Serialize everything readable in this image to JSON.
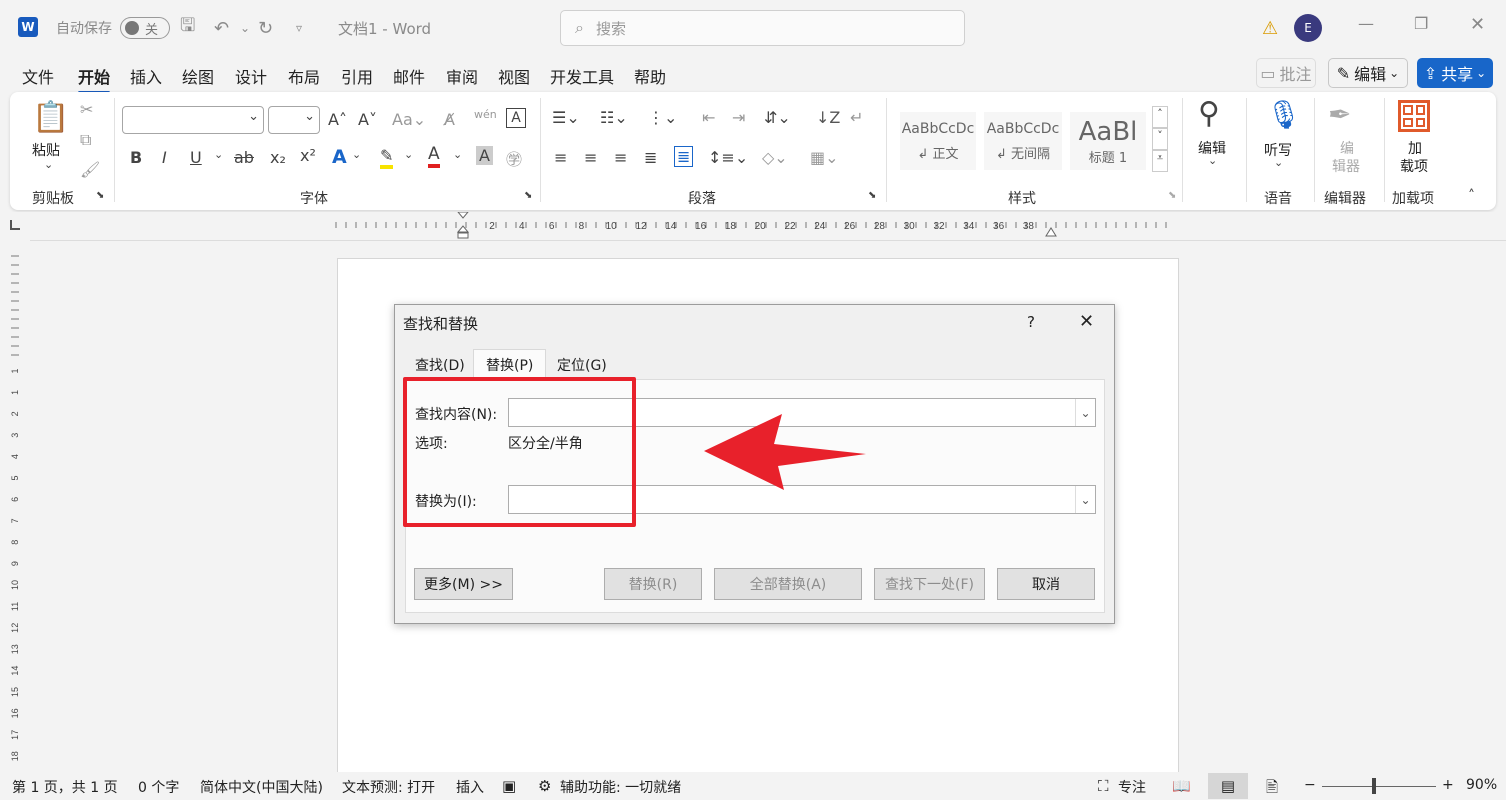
{
  "titlebar": {
    "autosave_label": "自动保存",
    "autosave_state": "关",
    "doc_title": "文档1 - Word",
    "search_placeholder": "搜索",
    "avatar_initial": "E"
  },
  "menu": [
    "文件",
    "开始",
    "插入",
    "绘图",
    "设计",
    "布局",
    "引用",
    "邮件",
    "审阅",
    "视图",
    "开发工具",
    "帮助"
  ],
  "menu_active": "开始",
  "right_actions": {
    "comment": "批注",
    "edit": "编辑",
    "share": "共享"
  },
  "ribbon": {
    "clipboard": {
      "paste": "粘贴",
      "group": "剪贴板"
    },
    "font": {
      "group": "字体"
    },
    "paragraph": {
      "group": "段落"
    },
    "styles": {
      "group": "样式",
      "items": [
        {
          "preview": "AaBbCcDc",
          "name": "↲ 正文"
        },
        {
          "preview": "AaBbCcDc",
          "name": "↲ 无间隔"
        },
        {
          "preview": "AaBl",
          "name": "标题 1"
        }
      ]
    },
    "editing": {
      "label": "编辑"
    },
    "voice": {
      "label": "听写",
      "group": "语音"
    },
    "editor": {
      "label1": "编",
      "label2": "辑器",
      "group": "编辑器"
    },
    "addins": {
      "label1": "加",
      "label2": "载项",
      "group": "加载项"
    }
  },
  "ruler_numbers": [
    "2",
    "4",
    "6",
    "8",
    "10",
    "12",
    "14",
    "16",
    "18",
    "20",
    "22",
    "24",
    "26",
    "28",
    "30",
    "32",
    "34",
    "36",
    "38"
  ],
  "vruler_numbers": [
    "1",
    "1",
    "2",
    "3",
    "4",
    "5",
    "6",
    "7",
    "8",
    "9",
    "10",
    "11",
    "12",
    "13",
    "14",
    "15",
    "16",
    "17",
    "18"
  ],
  "dialog": {
    "title": "查找和替换",
    "help": "?",
    "close": "✕",
    "tabs": [
      "查找(D)",
      "替换(P)",
      "定位(G)"
    ],
    "find_label": "查找内容(N):",
    "options_label": "选项:",
    "options_value": "区分全/半角",
    "replace_label": "替换为(I):",
    "buttons": {
      "more": "更多(M) >>",
      "replace": "替换(R)",
      "replace_all": "全部替换(A)",
      "find_next": "查找下一处(F)",
      "cancel": "取消"
    }
  },
  "annotation": {
    "highlight_color": "#e8212b",
    "arrow_color": "#e8212b"
  },
  "statusbar": {
    "page": "第 1 页，共 1 页",
    "words": "0 个字",
    "language": "简体中文(中国大陆)",
    "text_prediction": "文本预测: 打开",
    "insert": "插入",
    "accessibility": "辅助功能: 一切就绪",
    "focus": "专注",
    "zoom": "90%"
  }
}
